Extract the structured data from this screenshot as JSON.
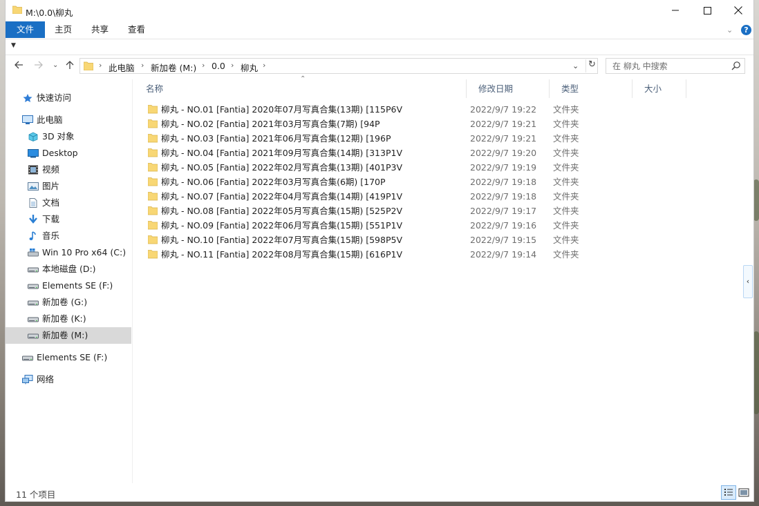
{
  "window": {
    "title": "M:\\0.0\\柳丸"
  },
  "ribbon": {
    "tabs": [
      "文件",
      "主页",
      "共享",
      "查看"
    ]
  },
  "address": {
    "crumbs": [
      "此电脑",
      "新加卷 (M:)",
      "0.0",
      "柳丸"
    ]
  },
  "search": {
    "placeholder": "在 柳丸 中搜索"
  },
  "navpane": {
    "quick_access": "快速访问",
    "this_pc": "此电脑",
    "items": [
      {
        "label": "3D 对象",
        "icon": "3d-objects-icon"
      },
      {
        "label": "Desktop",
        "icon": "desktop-icon"
      },
      {
        "label": "视频",
        "icon": "video-icon"
      },
      {
        "label": "图片",
        "icon": "pictures-icon"
      },
      {
        "label": "文档",
        "icon": "documents-icon"
      },
      {
        "label": "下载",
        "icon": "download-icon"
      },
      {
        "label": "音乐",
        "icon": "music-icon"
      },
      {
        "label": "Win 10 Pro x64 (C:)",
        "icon": "windows-drive-icon"
      },
      {
        "label": "本地磁盘 (D:)",
        "icon": "drive-icon"
      },
      {
        "label": "Elements SE (F:)",
        "icon": "drive-icon"
      },
      {
        "label": "新加卷 (G:)",
        "icon": "drive-icon"
      },
      {
        "label": "新加卷 (K:)",
        "icon": "drive-icon"
      },
      {
        "label": "新加卷 (M:)",
        "icon": "drive-icon",
        "selected": true
      }
    ],
    "external": "Elements SE (F:)",
    "network": "网络"
  },
  "columns": {
    "name": "名称",
    "date": "修改日期",
    "type": "类型",
    "size": "大小"
  },
  "files": [
    {
      "name": "柳丸 - NO.01 [Fantia] 2020年07月写真合集(13期) [115P6V",
      "date": "2022/9/7 19:22",
      "type": "文件夹"
    },
    {
      "name": "柳丸 - NO.02 [Fantia] 2021年03月写真合集(7期) [94P",
      "date": "2022/9/7 19:21",
      "type": "文件夹"
    },
    {
      "name": "柳丸 - NO.03 [Fantia] 2021年06月写真合集(12期) [196P",
      "date": "2022/9/7 19:21",
      "type": "文件夹"
    },
    {
      "name": "柳丸 - NO.04 [Fantia] 2021年09月写真合集(14期) [313P1V",
      "date": "2022/9/7 19:20",
      "type": "文件夹"
    },
    {
      "name": "柳丸 - NO.05 [Fantia] 2022年02月写真合集(13期) [401P3V",
      "date": "2022/9/7 19:19",
      "type": "文件夹"
    },
    {
      "name": "柳丸 - NO.06 [Fantia] 2022年03月写真合集(6期) [170P",
      "date": "2022/9/7 19:18",
      "type": "文件夹"
    },
    {
      "name": "柳丸 - NO.07 [Fantia] 2022年04月写真合集(14期) [419P1V",
      "date": "2022/9/7 19:18",
      "type": "文件夹"
    },
    {
      "name": "柳丸 - NO.08 [Fantia] 2022年05月写真合集(15期) [525P2V",
      "date": "2022/9/7 19:17",
      "type": "文件夹"
    },
    {
      "name": "柳丸 - NO.09 [Fantia] 2022年06月写真合集(15期) [551P1V",
      "date": "2022/9/7 19:16",
      "type": "文件夹"
    },
    {
      "name": "柳丸 - NO.10 [Fantia] 2022年07月写真合集(15期) [598P5V",
      "date": "2022/9/7 19:15",
      "type": "文件夹"
    },
    {
      "name": "柳丸 - NO.11 [Fantia] 2022年08月写真合集(15期) [616P1V",
      "date": "2022/9/7 19:14",
      "type": "文件夹"
    }
  ],
  "status": {
    "count": "11 个项目"
  },
  "colors": {
    "accent": "#1a6fc4",
    "folder": "#f8d775",
    "selected": "#d9d9d9",
    "header_text": "#4c607a"
  }
}
